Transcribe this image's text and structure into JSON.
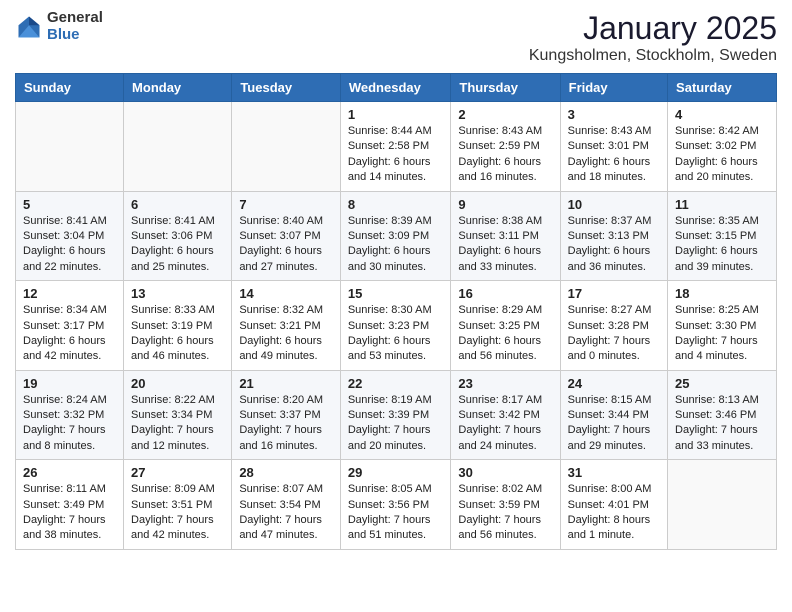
{
  "header": {
    "logo_general": "General",
    "logo_blue": "Blue",
    "month": "January 2025",
    "location": "Kungsholmen, Stockholm, Sweden"
  },
  "weekdays": [
    "Sunday",
    "Monday",
    "Tuesday",
    "Wednesday",
    "Thursday",
    "Friday",
    "Saturday"
  ],
  "weeks": [
    [
      {
        "day": "",
        "info": ""
      },
      {
        "day": "",
        "info": ""
      },
      {
        "day": "",
        "info": ""
      },
      {
        "day": "1",
        "info": "Sunrise: 8:44 AM\nSunset: 2:58 PM\nDaylight: 6 hours\nand 14 minutes."
      },
      {
        "day": "2",
        "info": "Sunrise: 8:43 AM\nSunset: 2:59 PM\nDaylight: 6 hours\nand 16 minutes."
      },
      {
        "day": "3",
        "info": "Sunrise: 8:43 AM\nSunset: 3:01 PM\nDaylight: 6 hours\nand 18 minutes."
      },
      {
        "day": "4",
        "info": "Sunrise: 8:42 AM\nSunset: 3:02 PM\nDaylight: 6 hours\nand 20 minutes."
      }
    ],
    [
      {
        "day": "5",
        "info": "Sunrise: 8:41 AM\nSunset: 3:04 PM\nDaylight: 6 hours\nand 22 minutes."
      },
      {
        "day": "6",
        "info": "Sunrise: 8:41 AM\nSunset: 3:06 PM\nDaylight: 6 hours\nand 25 minutes."
      },
      {
        "day": "7",
        "info": "Sunrise: 8:40 AM\nSunset: 3:07 PM\nDaylight: 6 hours\nand 27 minutes."
      },
      {
        "day": "8",
        "info": "Sunrise: 8:39 AM\nSunset: 3:09 PM\nDaylight: 6 hours\nand 30 minutes."
      },
      {
        "day": "9",
        "info": "Sunrise: 8:38 AM\nSunset: 3:11 PM\nDaylight: 6 hours\nand 33 minutes."
      },
      {
        "day": "10",
        "info": "Sunrise: 8:37 AM\nSunset: 3:13 PM\nDaylight: 6 hours\nand 36 minutes."
      },
      {
        "day": "11",
        "info": "Sunrise: 8:35 AM\nSunset: 3:15 PM\nDaylight: 6 hours\nand 39 minutes."
      }
    ],
    [
      {
        "day": "12",
        "info": "Sunrise: 8:34 AM\nSunset: 3:17 PM\nDaylight: 6 hours\nand 42 minutes."
      },
      {
        "day": "13",
        "info": "Sunrise: 8:33 AM\nSunset: 3:19 PM\nDaylight: 6 hours\nand 46 minutes."
      },
      {
        "day": "14",
        "info": "Sunrise: 8:32 AM\nSunset: 3:21 PM\nDaylight: 6 hours\nand 49 minutes."
      },
      {
        "day": "15",
        "info": "Sunrise: 8:30 AM\nSunset: 3:23 PM\nDaylight: 6 hours\nand 53 minutes."
      },
      {
        "day": "16",
        "info": "Sunrise: 8:29 AM\nSunset: 3:25 PM\nDaylight: 6 hours\nand 56 minutes."
      },
      {
        "day": "17",
        "info": "Sunrise: 8:27 AM\nSunset: 3:28 PM\nDaylight: 7 hours\nand 0 minutes."
      },
      {
        "day": "18",
        "info": "Sunrise: 8:25 AM\nSunset: 3:30 PM\nDaylight: 7 hours\nand 4 minutes."
      }
    ],
    [
      {
        "day": "19",
        "info": "Sunrise: 8:24 AM\nSunset: 3:32 PM\nDaylight: 7 hours\nand 8 minutes."
      },
      {
        "day": "20",
        "info": "Sunrise: 8:22 AM\nSunset: 3:34 PM\nDaylight: 7 hours\nand 12 minutes."
      },
      {
        "day": "21",
        "info": "Sunrise: 8:20 AM\nSunset: 3:37 PM\nDaylight: 7 hours\nand 16 minutes."
      },
      {
        "day": "22",
        "info": "Sunrise: 8:19 AM\nSunset: 3:39 PM\nDaylight: 7 hours\nand 20 minutes."
      },
      {
        "day": "23",
        "info": "Sunrise: 8:17 AM\nSunset: 3:42 PM\nDaylight: 7 hours\nand 24 minutes."
      },
      {
        "day": "24",
        "info": "Sunrise: 8:15 AM\nSunset: 3:44 PM\nDaylight: 7 hours\nand 29 minutes."
      },
      {
        "day": "25",
        "info": "Sunrise: 8:13 AM\nSunset: 3:46 PM\nDaylight: 7 hours\nand 33 minutes."
      }
    ],
    [
      {
        "day": "26",
        "info": "Sunrise: 8:11 AM\nSunset: 3:49 PM\nDaylight: 7 hours\nand 38 minutes."
      },
      {
        "day": "27",
        "info": "Sunrise: 8:09 AM\nSunset: 3:51 PM\nDaylight: 7 hours\nand 42 minutes."
      },
      {
        "day": "28",
        "info": "Sunrise: 8:07 AM\nSunset: 3:54 PM\nDaylight: 7 hours\nand 47 minutes."
      },
      {
        "day": "29",
        "info": "Sunrise: 8:05 AM\nSunset: 3:56 PM\nDaylight: 7 hours\nand 51 minutes."
      },
      {
        "day": "30",
        "info": "Sunrise: 8:02 AM\nSunset: 3:59 PM\nDaylight: 7 hours\nand 56 minutes."
      },
      {
        "day": "31",
        "info": "Sunrise: 8:00 AM\nSunset: 4:01 PM\nDaylight: 8 hours\nand 1 minute."
      },
      {
        "day": "",
        "info": ""
      }
    ]
  ]
}
